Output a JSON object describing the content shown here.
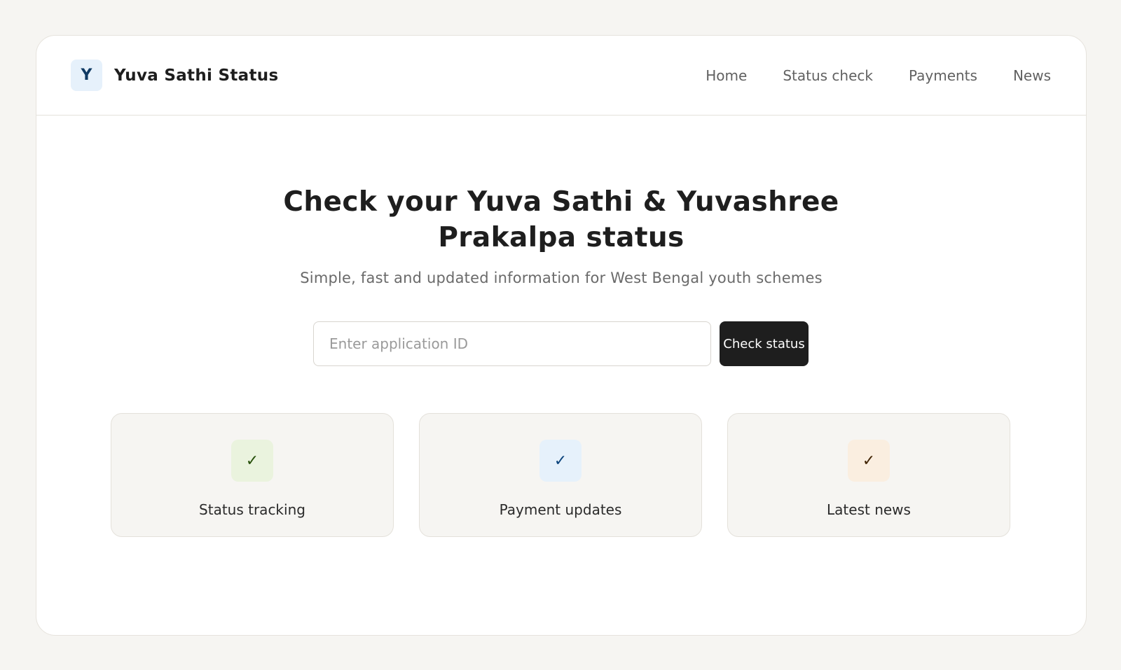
{
  "header": {
    "logo_letter": "Y",
    "brand_name": "Yuva Sathi Status",
    "nav": [
      "Home",
      "Status check",
      "Payments",
      "News"
    ]
  },
  "hero": {
    "title": "Check your Yuva Sathi & Yuvashree Prakalpa status",
    "subtitle": "Simple, fast and updated information for West Bengal youth schemes"
  },
  "search": {
    "placeholder": "Enter application ID",
    "value": "",
    "button_label": "Check status"
  },
  "features": [
    {
      "icon": "check-icon",
      "glyph": "✓",
      "label": "Status tracking",
      "bg_color": "#eaf3de",
      "fg_color": "#27500a"
    },
    {
      "icon": "check-icon",
      "glyph": "✓",
      "label": "Payment updates",
      "bg_color": "#e6f1fb",
      "fg_color": "#0c447c"
    },
    {
      "icon": "check-icon",
      "glyph": "✓",
      "label": "Latest news",
      "bg_color": "#faeee0",
      "fg_color": "#412402"
    }
  ],
  "colors": {
    "page_bg": "#f6f5f2",
    "accent_dark": "#1e1e1e",
    "logo_bg": "#e6f1fb",
    "logo_fg": "#0f3a63",
    "muted_text": "#6a6a6a"
  }
}
